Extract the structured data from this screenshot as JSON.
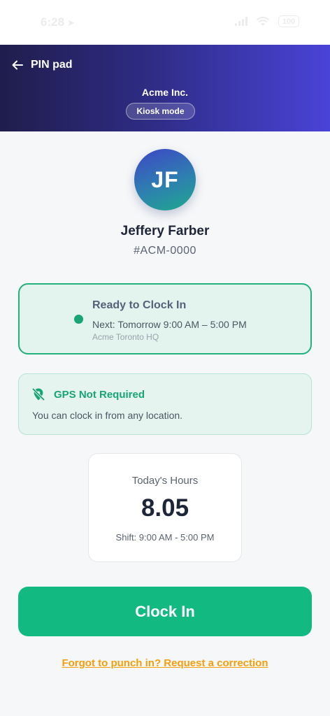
{
  "status_bar": {
    "time": "6:28",
    "battery": "100",
    "icons": [
      "location-arrow-icon",
      "signal-icon",
      "wifi-icon",
      "battery-icon"
    ]
  },
  "header": {
    "back_icon": "arrow-left-icon",
    "back_label": "PIN pad",
    "company": "Acme Inc.",
    "badge": "Kiosk mode",
    "gradient": [
      "#201d4c",
      "#4a43d8"
    ]
  },
  "employee": {
    "initials": "JF",
    "name": "Jeffery Farber",
    "id": "#ACM-0000"
  },
  "status_card": {
    "title": "Ready to Clock In",
    "next_shift": "Next: Tomorrow 9:00 AM – 5:00 PM",
    "location": "Acme Toronto HQ",
    "accent": "#22b07d"
  },
  "gps_card": {
    "icon": "location-off-icon",
    "title": "GPS Not Required",
    "description": "You can clock in from any location."
  },
  "hours_card": {
    "label": "Today's Hours",
    "value": "8.05",
    "shift": "Shift: 9:00 AM - 5:00 PM"
  },
  "actions": {
    "clock_in_label": "Clock In",
    "clock_in_color": "#12b981",
    "correction_link": "Forgot to punch in? Request a correction",
    "correction_color": "#f59e0b"
  }
}
